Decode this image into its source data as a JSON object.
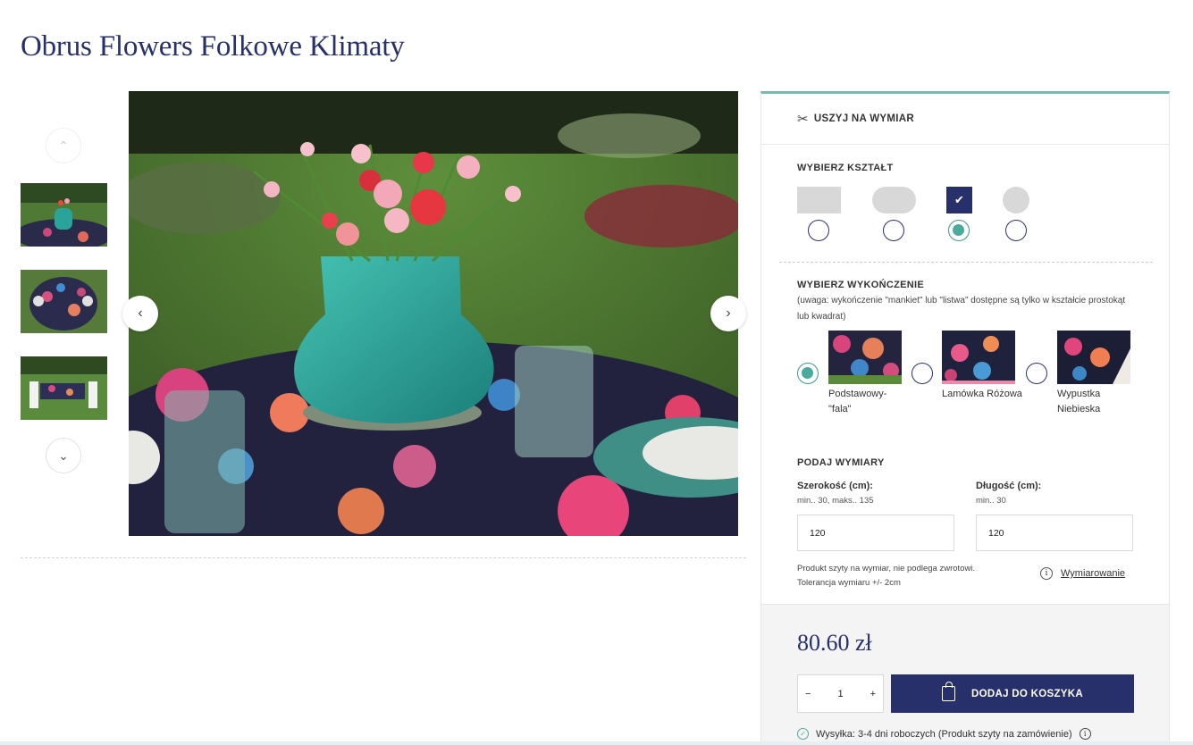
{
  "product": {
    "title": "Obrus Flowers Folkowe Klimaty"
  },
  "gallery": {
    "up_icon": "chevron-up-icon",
    "down_icon": "chevron-down-icon",
    "prev_icon": "chevron-left-icon",
    "next_icon": "chevron-right-icon",
    "thumbnails": 3
  },
  "panel": {
    "custom_label": "USZYJ NA WYMIAR",
    "custom_icon": "scissors-icon",
    "shape_label": "WYBIERZ KSZTAŁT",
    "shape_selected_index": 2,
    "finish_label": "WYBIERZ WYKOŃCZENIE",
    "finish_note": "(uwaga: wykończenie \"mankiet\" lub \"listwa\" dostępne są tylko w kształcie prostokąt lub kwadrat)",
    "finishes": [
      {
        "label": "Podstawowy- \"fala\"",
        "selected": true
      },
      {
        "label": "Lamówka Różowa",
        "selected": false
      },
      {
        "label": "Wypustka Niebieska",
        "selected": false
      }
    ],
    "dims_label": "PODAJ WYMIARY",
    "width_label": "Szerokość (cm):",
    "width_hint": "min.. 30, maks.. 135",
    "width_value": "120",
    "length_label": "Długość (cm):",
    "length_hint": "min.. 30",
    "length_value": "120",
    "return_note": "Produkt szyty na wymiar, nie podlega zwrotowi. Tolerancja wymiaru +/- 2cm",
    "measure_link": "Wymiarowanie"
  },
  "purchase": {
    "price": "80.60 zł",
    "qty_minus": "−",
    "qty_value": "1",
    "qty_plus": "+",
    "add_to_cart": "DODAJ DO KOSZYKA",
    "shipping": "Wysyłka: 3-4 dni roboczych (Produkt szyty na zamówienie)"
  },
  "colors": {
    "navy": "#27306b",
    "teal": "#4aab9a",
    "accent_border": "#7ab8b0"
  }
}
